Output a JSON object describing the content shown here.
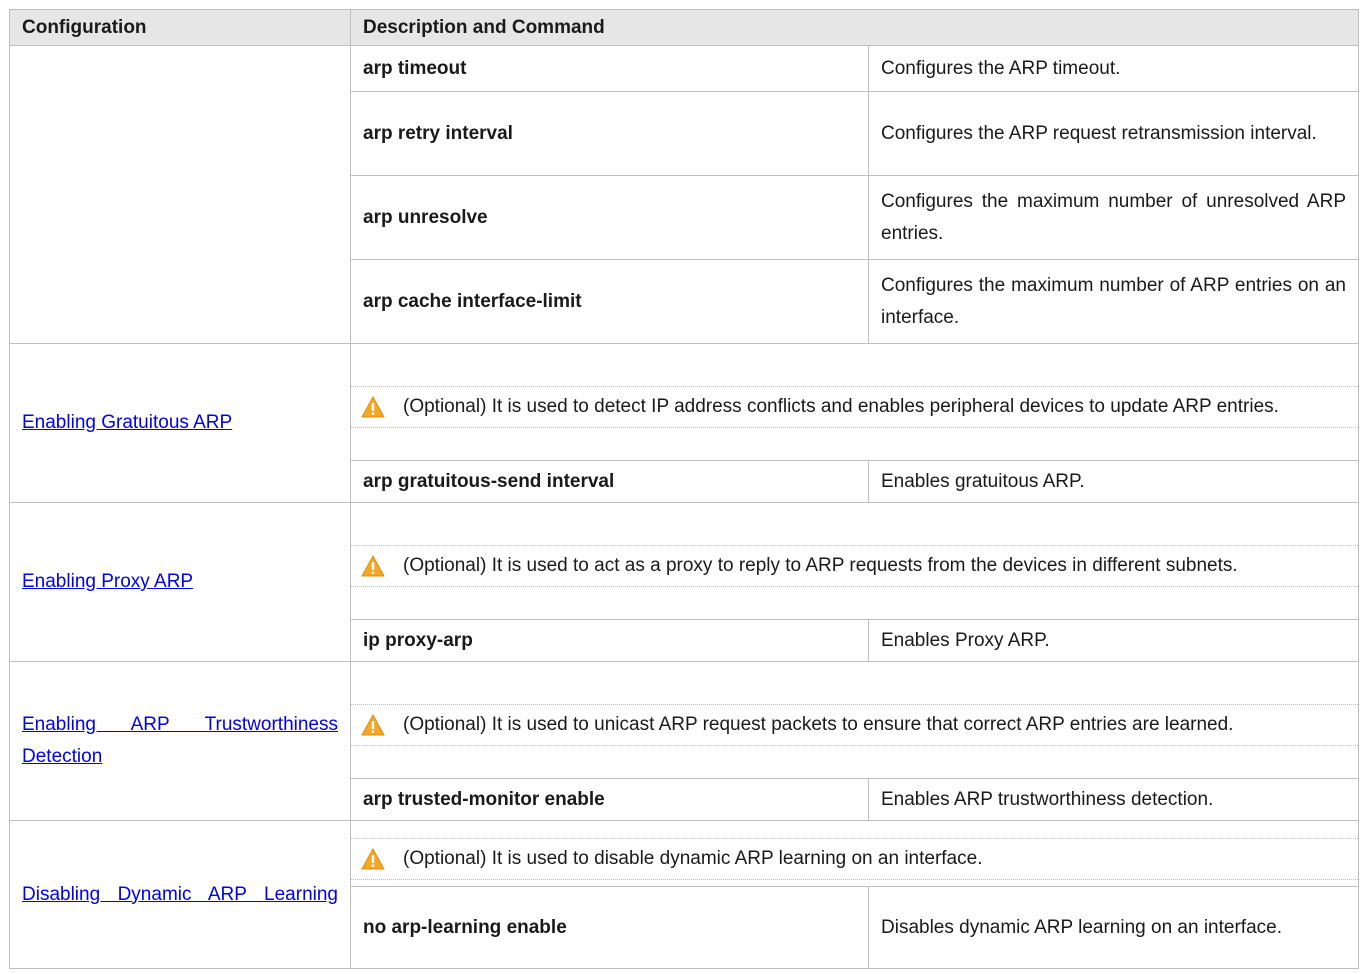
{
  "headers": {
    "configuration": "Configuration",
    "description_command": "Description and Command"
  },
  "top_group": [
    {
      "command": "arp timeout",
      "description": "Configures the ARP timeout."
    },
    {
      "command": "arp retry interval",
      "description": "Configures the ARP request retransmission interval."
    },
    {
      "command": "arp unresolve",
      "description": "Configures the maximum number of unresolved ARP entries."
    },
    {
      "command": "arp cache interface-limit",
      "description": "Configures the maximum number of ARP entries on an interface."
    }
  ],
  "sections": [
    {
      "link": "Enabling Gratuitous ARP",
      "note": "(Optional) It is used to detect IP address conflicts and enables peripheral devices to update ARP entries.",
      "command": "arp gratuitous-send interval",
      "description": "Enables gratuitous ARP."
    },
    {
      "link": "Enabling Proxy ARP",
      "note": "(Optional) It is used to act as a proxy to reply to ARP requests from the devices in different subnets.",
      "command": "ip proxy-arp",
      "description": "Enables Proxy ARP."
    },
    {
      "link": "Enabling ARP Trustworthiness Detection",
      "note": "(Optional) It is used to unicast ARP request packets to ensure that correct ARP entries are learned.",
      "command": "arp trusted-monitor enable",
      "description": "Enables ARP trustworthiness detection."
    },
    {
      "link": "Disabling Dynamic ARP Learning",
      "note": "(Optional) It is used to disable dynamic ARP learning on an interface.",
      "command": "no arp-learning enable",
      "description": "Disables dynamic ARP learning on an interface."
    }
  ],
  "icon": {
    "name": "warning-icon",
    "color": "#f5a623"
  }
}
